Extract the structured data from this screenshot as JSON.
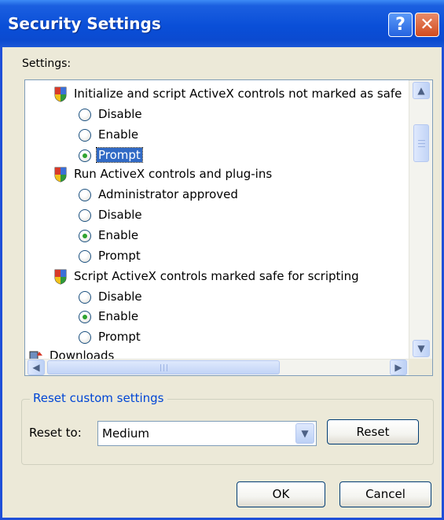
{
  "window": {
    "title": "Security Settings",
    "help_glyph": "?",
    "close_glyph": "✕"
  },
  "settings": {
    "label": "Settings:",
    "groups": [
      {
        "label": "Initialize and script ActiveX controls not marked as safe",
        "icon": "shield-icon",
        "options": [
          {
            "label": "Disable",
            "checked": false
          },
          {
            "label": "Enable",
            "checked": false
          },
          {
            "label": "Prompt",
            "checked": true,
            "selected": true
          }
        ]
      },
      {
        "label": "Run ActiveX controls and plug-ins",
        "icon": "shield-icon",
        "options": [
          {
            "label": "Administrator approved",
            "checked": false
          },
          {
            "label": "Disable",
            "checked": false
          },
          {
            "label": "Enable",
            "checked": true
          },
          {
            "label": "Prompt",
            "checked": false
          }
        ]
      },
      {
        "label": "Script ActiveX controls marked safe for scripting",
        "icon": "shield-icon",
        "options": [
          {
            "label": "Disable",
            "checked": false
          },
          {
            "label": "Enable",
            "checked": true
          },
          {
            "label": "Prompt",
            "checked": false
          }
        ]
      }
    ],
    "partial_item": {
      "label": "Downloads",
      "icon": "downloads-icon"
    },
    "scroll_glyphs": {
      "up": "▲",
      "down": "▼",
      "left": "◀",
      "right": "▶"
    }
  },
  "reset": {
    "group_title": "Reset custom settings",
    "reset_to_label": "Reset to:",
    "selected_level": "Medium",
    "reset_button": "Reset"
  },
  "footer": {
    "ok_label": "OK",
    "cancel_label": "Cancel"
  }
}
